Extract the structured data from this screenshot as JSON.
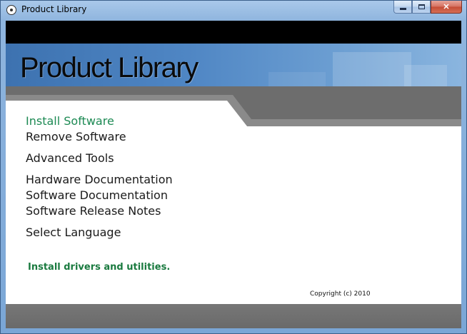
{
  "window": {
    "title": "Product Library",
    "icon": "disc-icon",
    "caption_buttons": [
      "minimize-icon",
      "maximize-icon",
      "close-icon"
    ],
    "close_glyph": "✕"
  },
  "banner": {
    "title": "Product Library"
  },
  "menu": {
    "items": [
      {
        "label": "Install Software",
        "active": true
      },
      {
        "label": "Remove Software"
      },
      {
        "label": "Advanced Tools"
      },
      {
        "label": "Hardware Documentation"
      },
      {
        "label": "Software Documentation"
      },
      {
        "label": "Software Release Notes"
      },
      {
        "label": "Select Language"
      }
    ]
  },
  "status": {
    "description": "Install drivers and utilities."
  },
  "footer": {
    "copyright": "Copyright (c) 2010"
  },
  "colors": {
    "active_link": "#1d8a54",
    "status_text": "#1a7a3f",
    "banner_blue": "#4f86c4",
    "band_gray": "#6a6a6a"
  }
}
